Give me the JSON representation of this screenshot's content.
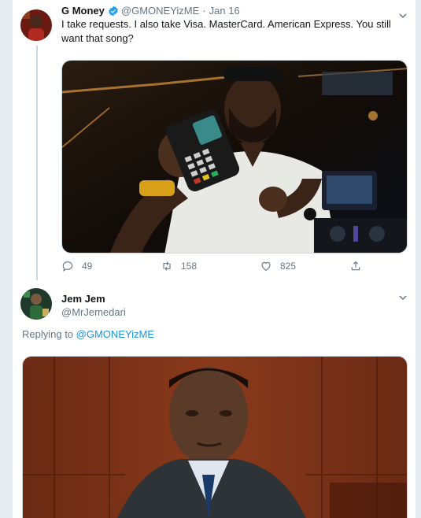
{
  "tweet": {
    "author_name": "G Money",
    "author_handle": "@GMONEYizME",
    "separator": "·",
    "date": "Jan 16",
    "text": "I take requests. I also take Visa. MasterCard. American Express. You still want that song?",
    "image_caption": "Man holding a card payment terminal in front of a DJ setup",
    "actions": {
      "replies": "49",
      "retweets": "158",
      "likes": "825"
    },
    "icons": {
      "verified": "verified-badge-icon",
      "reply": "comment-icon",
      "retweet": "retweet-icon",
      "like": "heart-icon",
      "share": "share-icon",
      "menu": "chevron-down-icon"
    }
  },
  "reply": {
    "author_name": "Jem Jem",
    "author_handle": "@MrJemedari",
    "replying_prefix": "Replying to",
    "replying_to": "@GMONEYizME",
    "image_caption": "Man in suit seated in a wood-paneled courtroom"
  },
  "colors": {
    "link": "#1b95e0",
    "muted": "#657786",
    "text": "#14171a",
    "border": "#e6ecf0"
  }
}
